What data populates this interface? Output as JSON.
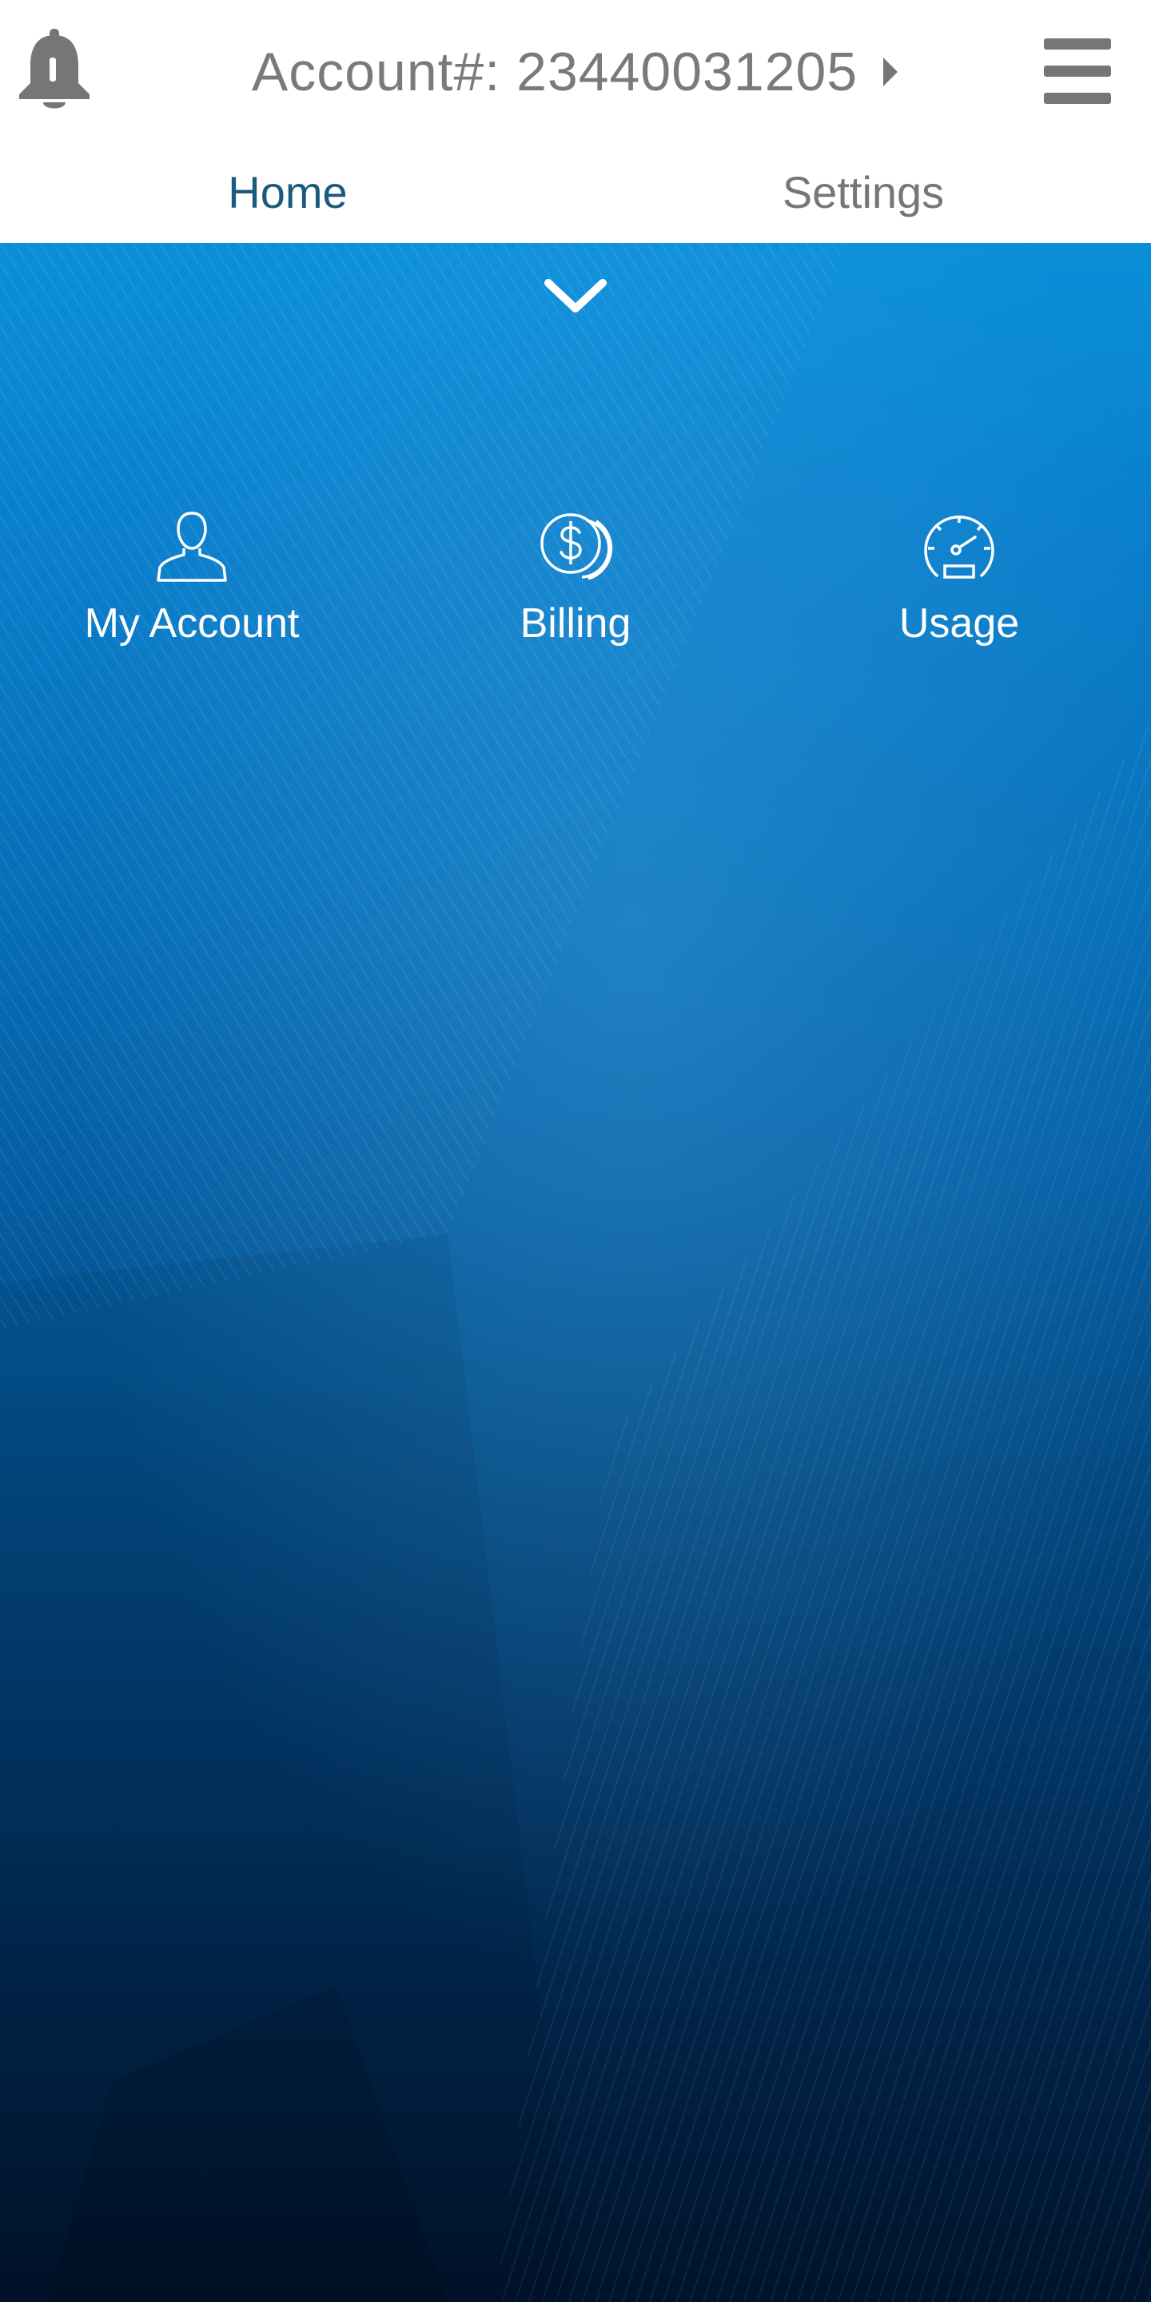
{
  "header": {
    "account_label": "Account#: 23440031205",
    "icons": {
      "left": "bell-icon",
      "account_caret": "caret-right-icon",
      "right": "hamburger-menu-icon"
    },
    "colors": {
      "icon_gray": "#767676",
      "text_gray": "#7a7a7a"
    }
  },
  "tabs": [
    {
      "label": "Home",
      "active": true,
      "color": "#1a5a7e"
    },
    {
      "label": "Settings",
      "active": false,
      "color": "#767676"
    }
  ],
  "hero": {
    "collapse_icon": "chevron-down-icon",
    "gradient_top": "#0a8fd9",
    "gradient_bottom": "#00132b",
    "quick_links": [
      {
        "label": "My Account",
        "icon": "user-icon"
      },
      {
        "label": "Billing",
        "icon": "dollar-coins-icon"
      },
      {
        "label": "Usage",
        "icon": "speedometer-icon"
      }
    ]
  }
}
